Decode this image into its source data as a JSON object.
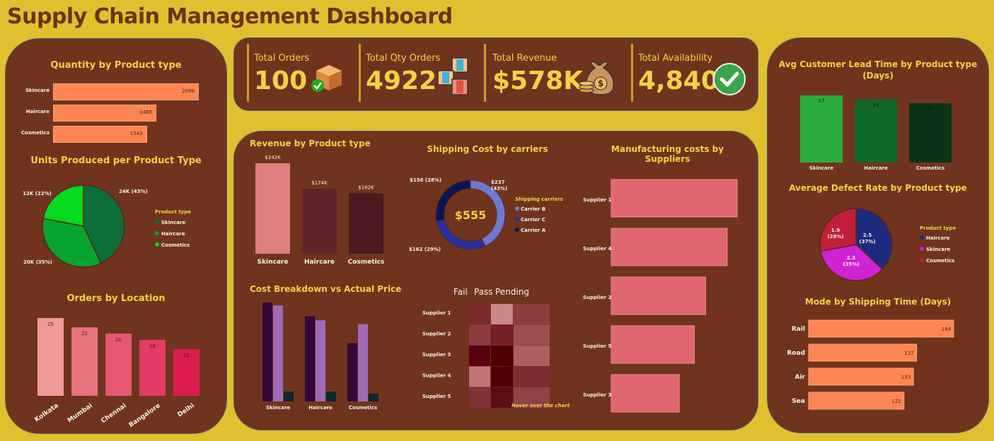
{
  "header": {
    "title": "Supply Chain Management Dashboard"
  },
  "kpis": [
    {
      "label": "Total Orders",
      "value": "100",
      "icon": "box-check-icon"
    },
    {
      "label": "Total Qty Orders",
      "value": "4922",
      "icon": "boxes-icon"
    },
    {
      "label": "Total Revenue",
      "value": "$578K",
      "icon": "money-bag-icon"
    },
    {
      "label": "Total Availability",
      "value": "4,840",
      "icon": "check-circle-icon"
    }
  ],
  "colors": {
    "page": "#e0c02f",
    "panel": "#70341e",
    "title": "#f2d245",
    "accent": "#ff8552"
  },
  "charts": {
    "qty_by_type": {
      "type": "bar",
      "title": "Quantity by Product type",
      "categories": [
        "Skincare",
        "Haircare",
        "Cosmetics"
      ],
      "values": [
        2099,
        1480,
        1343
      ],
      "labels": [
        "2099",
        "1480",
        "1343"
      ]
    },
    "units_produced": {
      "type": "pie",
      "title": "Units Produced per Product Type",
      "legend_title": "Product type",
      "legend": [
        "Skincare",
        "Haircare",
        "Cosmetics"
      ],
      "values": [
        43,
        35,
        22
      ],
      "labels": [
        "24K (43%)",
        "20K (35%)",
        "12K (22%)"
      ],
      "colors": [
        "#0c6e38",
        "#07a52f",
        "#02d91f"
      ]
    },
    "orders_by_location": {
      "type": "bar",
      "title": "Orders by Location",
      "categories": [
        "Kolkata",
        "Mumbai",
        "Chennai",
        "Bangalore",
        "Delhi"
      ],
      "values": [
        25,
        22,
        20,
        18,
        15
      ],
      "labels": [
        "25",
        "22",
        "20",
        "18",
        "15"
      ],
      "colors": [
        "#ee9a98",
        "#e9727f",
        "#e65872",
        "#e23b66",
        "#dc1c4f"
      ]
    },
    "revenue_by_type": {
      "type": "bar",
      "title": "Revenue by Product type",
      "categories": [
        "Skincare",
        "Haircare",
        "Cosmetics"
      ],
      "values": [
        242,
        174,
        162
      ],
      "labels": [
        "$242K",
        "$174K",
        "$162K"
      ],
      "colors": [
        "#e08080",
        "#60242a",
        "#4d1a22"
      ]
    },
    "shipping_cost": {
      "type": "pie",
      "title": "Shipping Cost by carriers",
      "center": "$555",
      "legend_title": "Shipping carriers",
      "legend": [
        "Carrier B",
        "Carrier C",
        "Carrier A"
      ],
      "values": [
        43,
        29,
        28
      ],
      "labels": [
        "$237 (43%)",
        "$162 (29%)",
        "$156 (28%)"
      ],
      "colors": [
        "#7079d0",
        "#272fa0",
        "#0d1550"
      ]
    },
    "manufacturing_costs": {
      "type": "bar",
      "title": "Manufacturing costs by Suppliers",
      "categories": [
        "Supplier 1",
        "Supplier 4",
        "Supplier 2",
        "Supplier 5",
        "Supplier 3"
      ],
      "values": [
        100,
        92,
        75,
        66,
        54
      ]
    },
    "cost_breakdown": {
      "type": "bar",
      "title": "Cost Breakdown vs Actual Price",
      "categories": [
        "Skincare",
        "Haircare",
        "Cosmetics"
      ],
      "series": [
        {
          "values": [
            100,
            86,
            59
          ],
          "color": "#34083a"
        },
        {
          "values": [
            97,
            82,
            78
          ],
          "color": "#a06ab8"
        },
        {
          "values": [
            10,
            10,
            8
          ],
          "color": "#0c2a2c"
        }
      ]
    },
    "inspection": {
      "type": "heatmap",
      "columns": [
        "Fail",
        "Pass",
        "Pending"
      ],
      "rows": [
        "Supplier 1",
        "Supplier 2",
        "Supplier 3",
        "Supplier 4",
        "Supplier 5"
      ],
      "colors": [
        [
          "#7a2b2d",
          "#cb8787",
          "#8b3e3e"
        ],
        [
          "#8e3b40",
          "#761d26",
          "#9a5050"
        ],
        [
          "#590010",
          "#4d0000",
          "#aa6060"
        ],
        [
          "#c07575",
          "#4e0006",
          "#7c2d32"
        ],
        [
          "#7f3338",
          "#570f14",
          "#8f4347"
        ]
      ],
      "hint": "Hover over the chart"
    },
    "lead_time": {
      "type": "bar",
      "title": "Avg Customer Lead Time by Product type (Days)",
      "categories": [
        "Skincare",
        "Haircare",
        "Cosmetics"
      ],
      "values": [
        17,
        16,
        15
      ],
      "labels": [
        "17",
        "16",
        "15"
      ],
      "colors": [
        "#2aad3a",
        "#11692a",
        "#0b3317"
      ]
    },
    "defect_rate": {
      "type": "pie",
      "title": "Average Defect Rate by Product type",
      "legend_title": "Product type",
      "legend": [
        "Haircare",
        "Skincare",
        "Cosmetics"
      ],
      "values": [
        37,
        35,
        28
      ],
      "labels": [
        "2.5 (37%)",
        "2.3 (35%)",
        "1.9 (28%)"
      ],
      "colors": [
        "#1d2a80",
        "#cf23d4",
        "#c0203a"
      ]
    },
    "shipping_mode": {
      "type": "bar",
      "title": "Mode by Shipping Time (Days)",
      "categories": [
        "Rail",
        "Road",
        "Air",
        "Sea"
      ],
      "values": [
        184,
        137,
        133,
        121
      ],
      "labels": [
        "184",
        "137",
        "133",
        "121"
      ]
    }
  }
}
